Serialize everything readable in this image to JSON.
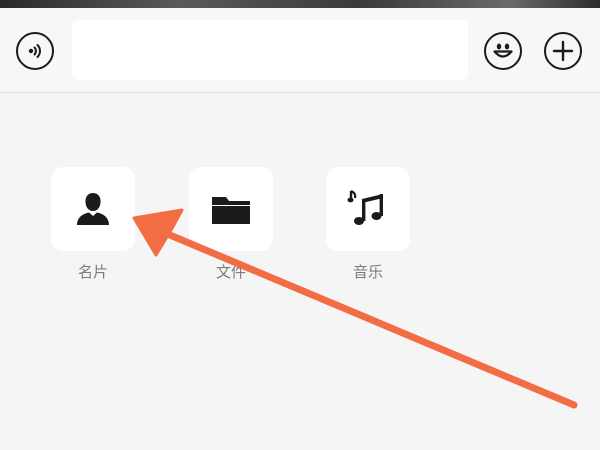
{
  "input_bar": {
    "text_value": "",
    "placeholder": "",
    "voice_icon": "voice-icon",
    "emoji_icon": "smiley-icon",
    "plus_icon": "plus-icon"
  },
  "tools": [
    {
      "label": "名片",
      "icon": "person-icon"
    },
    {
      "label": "文件",
      "icon": "folder-icon"
    },
    {
      "label": "音乐",
      "icon": "music-note-icon"
    }
  ],
  "annotation": {
    "arrow_color": "#f26d44",
    "points_to": "名片"
  },
  "colors": {
    "background": "#f5f5f5",
    "tile": "#ffffff",
    "icon": "#1b1b1b",
    "label": "#7b7b7b"
  }
}
